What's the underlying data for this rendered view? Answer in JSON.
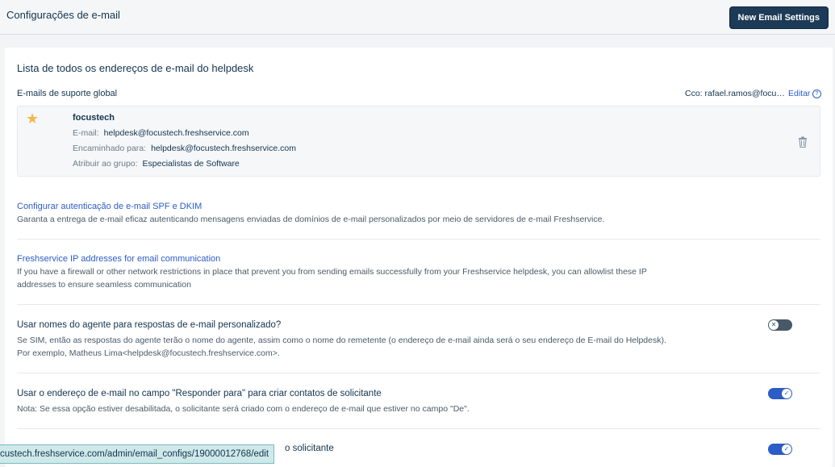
{
  "header": {
    "title": "Configurações de e-mail",
    "new_button": "New Email Settings"
  },
  "list": {
    "title": "Lista de todos os endereços de e-mail do helpdesk",
    "global_label": "E-mails de suporte global",
    "cc": "Cco: rafael.ramos@focu…",
    "edit": "Editar",
    "help_glyph": "?"
  },
  "mailbox": {
    "name": "focustech",
    "email_label": "E-mail:",
    "email_value": "helpdesk@focustech.freshservice.com",
    "forward_label": "Encaminhado para:",
    "forward_value": "helpdesk@focustech.freshservice.com",
    "group_label": "Atribuir ao grupo:",
    "group_value": "Especialistas de Software",
    "star_glyph": "★"
  },
  "spf": {
    "link": "Configurar autenticação de e-mail SPF e DKIM",
    "desc": "Garanta a entrega de e-mail eficaz autenticando mensagens enviadas de domínios de e-mail personalizados por meio de servidores de e-mail Freshservice."
  },
  "ip": {
    "link": "Freshservice IP addresses for email communication",
    "desc": "If you have a firewall or other network restrictions in place that prevent you from sending emails successfully from your Freshservice helpdesk, you can allowlist these IP addresses to ensure seamless communication"
  },
  "options": [
    {
      "title": "Usar nomes do agente para respostas de e-mail personalizado?",
      "desc": "Se SIM, então as respostas do agente terão o nome do agente, assim como o nome do remetente (o endereço de e-mail ainda será o seu endereço de E-mail do Helpdesk). Por exemplo, Matheus Lima<helpdesk@focustech.freshservice.com>.",
      "state": "off",
      "glyph": "✕"
    },
    {
      "title": "Usar o endereço de e-mail no campo \"Responder para\" para criar contatos de solicitante",
      "desc": "Nota: Se essa opção estiver desabilitada, o solicitante será criado com o endereço de e-mail que estiver no campo \"De\".",
      "state": "on",
      "glyph": "✓"
    },
    {
      "title": "o solicitante",
      "state": "on",
      "glyph": "✓"
    }
  ],
  "status_url": "custech.freshservice.com/admin/email_configs/19000012768/edit",
  "colors": {
    "primary_button": "#1d3a57",
    "link": "#2c5cc5",
    "toggle_on": "#2c5cc5",
    "toggle_off": "#475867",
    "star": "#f2b84b"
  }
}
